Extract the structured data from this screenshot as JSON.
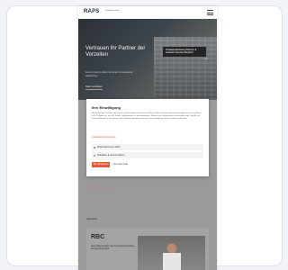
{
  "site": {
    "logo": "RAPS",
    "logo_sub": "Immobilien & Bau"
  },
  "hero": {
    "title": "Vertrauen Ihr Partner der Vorzeiten",
    "subtitle": "Lorem ipsum dolor sit amet consectetur adipiscing",
    "button": "Mehr erfahren",
    "tag": "Projektentwicklung Wohnen & Gewerbe Neubau Bestand",
    "arrow": "→"
  },
  "cookie_dialog": {
    "title": "Ihre Einwilligung",
    "text": "Wir verwenden Cookies und ähnliche Technologien auf unserer Website und verarbeiten personenbezogene Daten von Ihnen (z.B. IP-Adresse), um z.B. Inhalte und Anzeigen zu personalisieren, Medien von Drittanbietern einzubinden oder Zugriffe auf unsere Website zu analysieren. Die Datenverarbeitung kann auch erst in Folge gesetzter Cookies stattfinden.",
    "more_link": "Individuelle Einstellungen",
    "options": [
      {
        "label": "Essenziell (immer aktiv)",
        "color": "#e05a3c"
      },
      {
        "label": "Statistiken & externe Medien",
        "color": "#9a9a9a"
      }
    ],
    "accept_label": "Alle akzeptieren",
    "settings_label": "Nur essenzielle"
  },
  "below": {
    "link": "Mehr zum Unternehmen",
    "section_label": "Aktuelles",
    "card_logo": "RBC",
    "card_text": "Neues Bauprojekt in der Innenstadt gestartet – Fertigstellung 2025"
  }
}
